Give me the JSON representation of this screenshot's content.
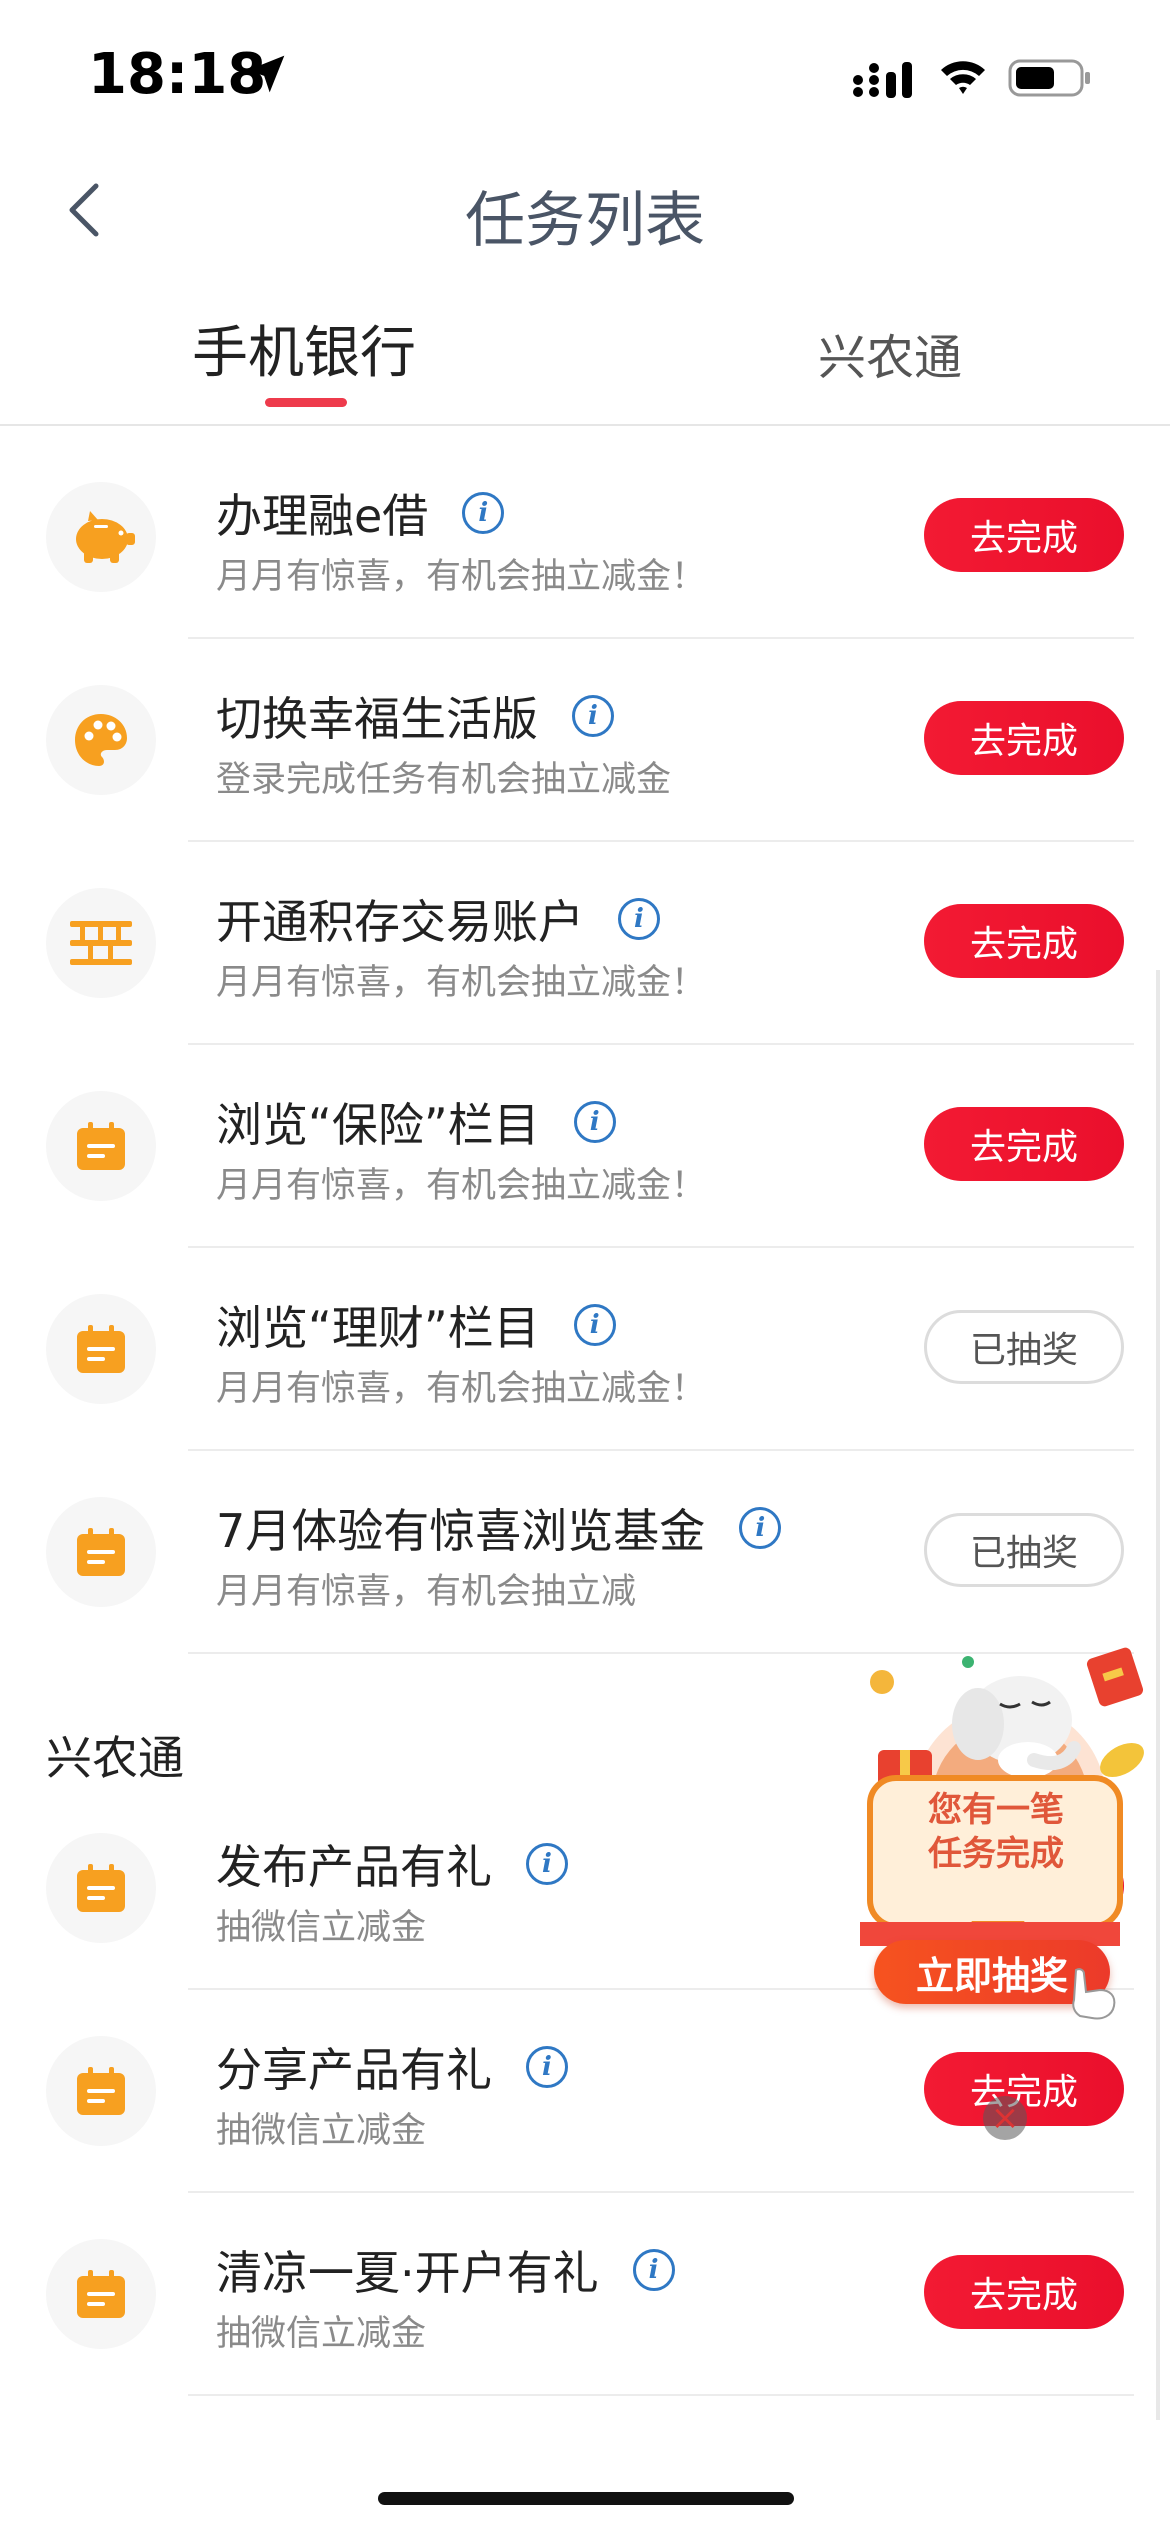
{
  "status": {
    "time": "18:18"
  },
  "nav": {
    "title": "任务列表"
  },
  "tabs": [
    {
      "label": "手机银行",
      "active": true
    },
    {
      "label": "兴农通",
      "active": false
    }
  ],
  "section1_tasks": [
    {
      "title": "办理融e借",
      "subtitle": "月月有惊喜，有机会抽立减金！",
      "button": "去完成",
      "state": "todo",
      "icon": "piggy-bank-icon"
    },
    {
      "title": "切换幸福生活版",
      "subtitle": "登录完成任务有机会抽立减金",
      "button": "去完成",
      "state": "todo",
      "icon": "palette-icon"
    },
    {
      "title": "开通积存交易账户",
      "subtitle": "月月有惊喜，有机会抽立减金！",
      "button": "去完成",
      "state": "todo",
      "icon": "abacus-icon"
    },
    {
      "title": "浏览“保险”栏目",
      "subtitle": "月月有惊喜，有机会抽立减金！",
      "button": "去完成",
      "state": "todo",
      "icon": "calendar-icon"
    },
    {
      "title": "浏览“理财”栏目",
      "subtitle": "月月有惊喜，有机会抽立减金！",
      "button": "已抽奖",
      "state": "done",
      "icon": "calendar-icon"
    },
    {
      "title": "7月体验有惊喜浏览基金",
      "subtitle": "月月有惊喜，有机会抽立减",
      "button": "已抽奖",
      "state": "done",
      "icon": "calendar-icon"
    }
  ],
  "section2": {
    "title": "兴农通",
    "tasks": [
      {
        "title": "发布产品有礼",
        "subtitle": "抽微信立减金",
        "button": "",
        "state": "todo",
        "icon": "calendar-icon"
      },
      {
        "title": "分享产品有礼",
        "subtitle": "抽微信立减金",
        "button": "去完成",
        "state": "todo",
        "icon": "calendar-icon"
      },
      {
        "title": "清凉一夏·开户有礼",
        "subtitle": "抽微信立减金",
        "button": "去完成",
        "state": "todo",
        "icon": "calendar-icon"
      }
    ]
  },
  "promo": {
    "line1": "您有一笔",
    "line2": "任务完成",
    "cta": "立即抽奖"
  },
  "colors": {
    "accent_red": "#ee1a30",
    "icon_orange": "#f7a020",
    "info_blue": "#2f78c4"
  }
}
